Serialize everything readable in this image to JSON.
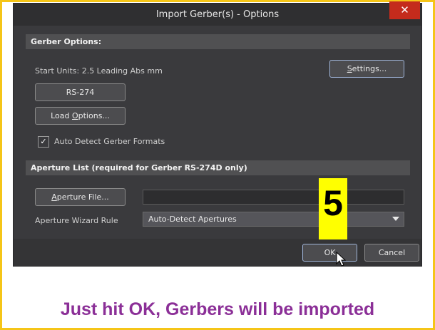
{
  "dialog": {
    "title": "Import Gerber(s) - Options",
    "close_glyph": "✕",
    "gerber_options": {
      "header": "Gerber Options:",
      "start_units": "Start Units: 2.5 Leading Abs mm",
      "settings_button": "Settings...",
      "rs274_button": "RS-274",
      "load_options_button": "Load Options...",
      "auto_detect_label": "Auto Detect Gerber Formats",
      "auto_detect_checked": true
    },
    "aperture_list": {
      "header": "Aperture List (required for Gerber RS-274D only)",
      "aperture_file_button": "Aperture File...",
      "aperture_file_value": "",
      "wizard_rule_label": "Aperture Wizard Rule",
      "wizard_rule_value": "Auto-Detect Apertures"
    },
    "footer": {
      "ok_button": "OK",
      "cancel_button": "Cancel"
    }
  },
  "annotation": {
    "step_number": "5",
    "caption": "Just hit OK, Gerbers will be imported",
    "colors": {
      "frame": "#f5c518",
      "step_badge": "#ffff00",
      "caption": "#8b2f97"
    }
  }
}
